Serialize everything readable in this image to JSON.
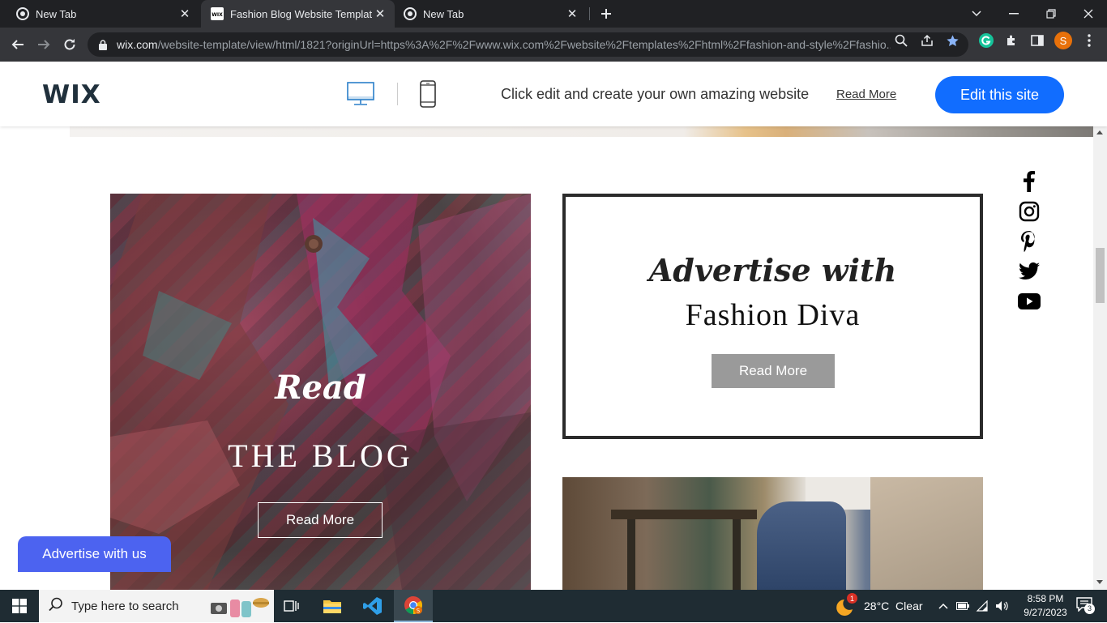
{
  "browser": {
    "tabs": [
      {
        "title": "New Tab",
        "active": false
      },
      {
        "title": "Fashion Blog Website Template |",
        "active": true
      },
      {
        "title": "New Tab",
        "active": false
      }
    ],
    "url_host": "wix.com",
    "url_path": "/website-template/view/html/1821?originUrl=https%3A%2F%2Fwww.wix.com%2Fwebsite%2Ftemplates%2Fhtml%2Ffashion-and-style%2Ffashio...",
    "profile_initial": "S"
  },
  "wix_bar": {
    "logo": "WIX",
    "tagline": "Click edit and create your own amazing website",
    "read_more": "Read More",
    "edit_button": "Edit this site"
  },
  "content": {
    "blog_card": {
      "script_text": "Read",
      "title": "THE BLOG",
      "button": "Read More"
    },
    "ad_card": {
      "script_text": "Advertise with",
      "brand": "Fashion Diva",
      "button": "Read More"
    },
    "social_icons": [
      "facebook-icon",
      "instagram-icon",
      "pinterest-icon",
      "twitter-icon",
      "youtube-icon"
    ],
    "floating_button": "Advertise with us"
  },
  "taskbar": {
    "search_placeholder": "Type here to search",
    "weather": "28°C  Clear",
    "time": "8:58 PM",
    "date": "9/27/2023",
    "notification_count": "3",
    "weather_badge": "1"
  },
  "colors": {
    "wix_blue": "#116dff",
    "float_button": "#4c63f0",
    "ad_button": "#9a9a9a",
    "ad_border": "#2b2b2b"
  }
}
